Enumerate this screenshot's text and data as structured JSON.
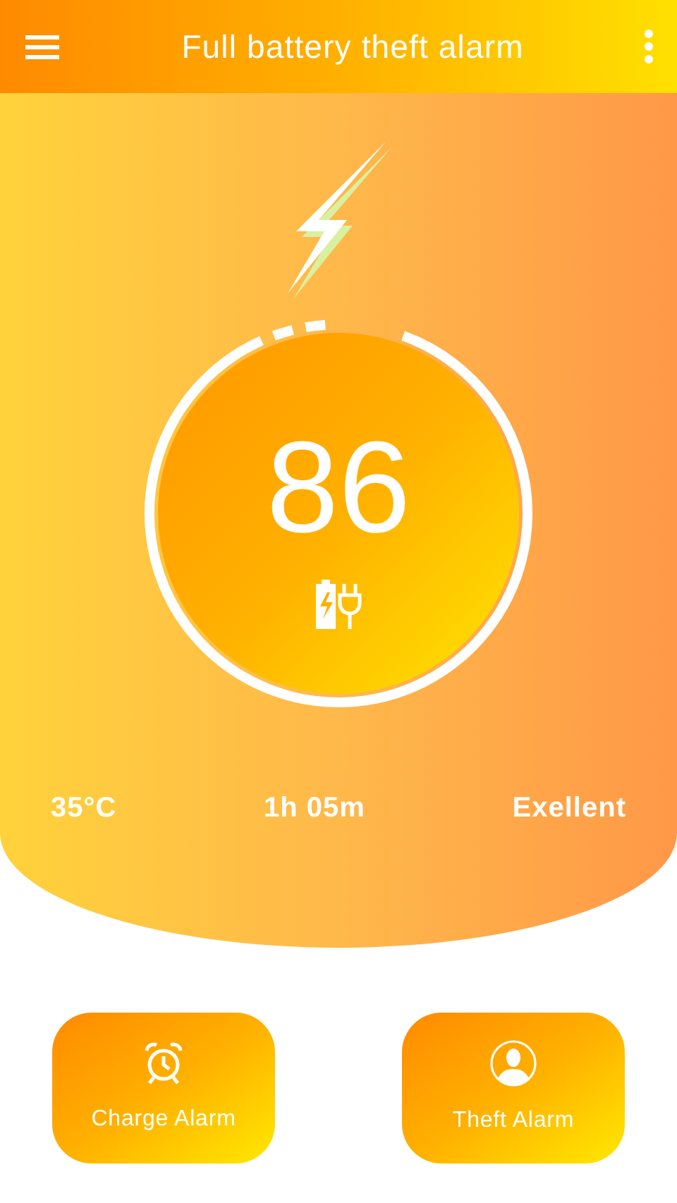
{
  "header": {
    "title": "Full battery theft alarm"
  },
  "gauge": {
    "value": "86",
    "charging": true
  },
  "stats": [
    "35°C",
    "1h 05m",
    "Exellent"
  ],
  "buttons": [
    {
      "label": "Charge Alarm",
      "kind": "alarm"
    },
    {
      "label": "Theft Alarm",
      "kind": "person"
    }
  ]
}
